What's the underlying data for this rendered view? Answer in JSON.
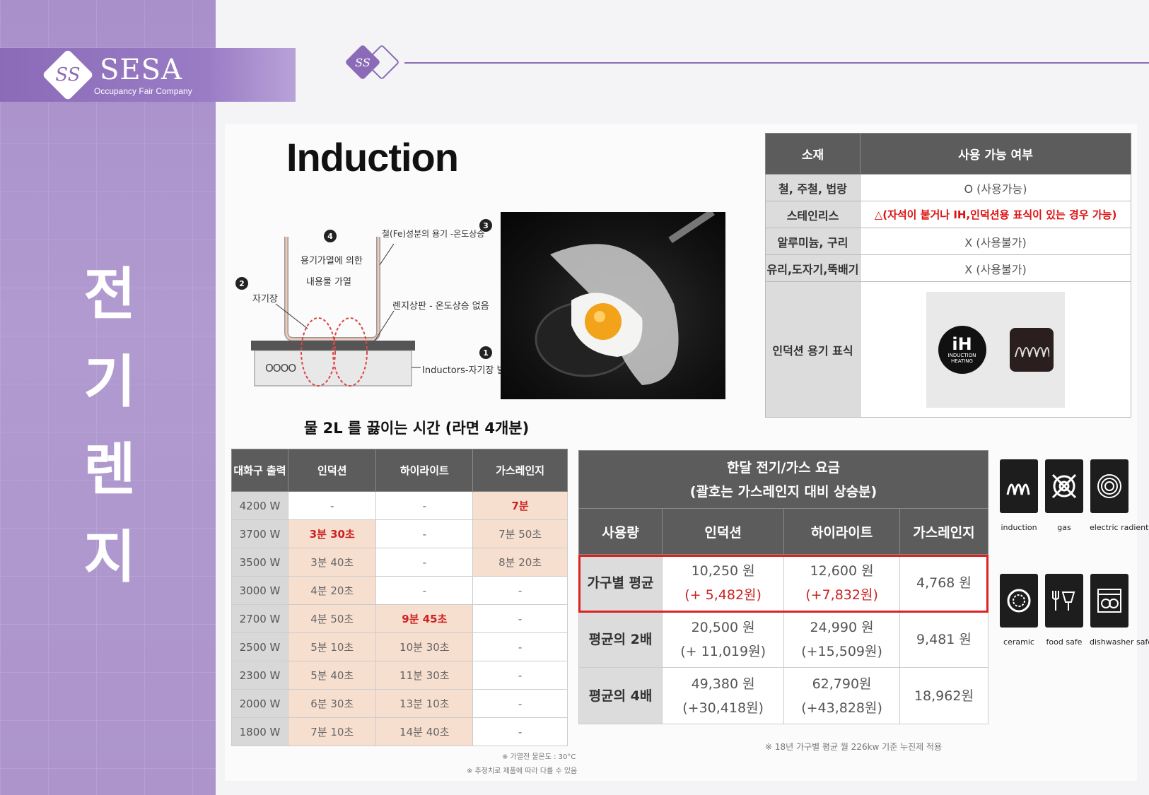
{
  "brand": {
    "name": "SESA",
    "tagline": "Occupancy Fair Company",
    "mark": "SS"
  },
  "page_title": [
    "전",
    "기",
    "렌",
    "지"
  ],
  "induction_title": "Induction",
  "diagram": {
    "labels": {
      "vessel_heat": "철(Fe)성분의 용기 -온도상승",
      "content_heat_1": "용기가열에 의한",
      "content_heat_2": "내용물 가열",
      "magnetic_field": "자기장",
      "plate": "렌지상판 - 온도상승 없음",
      "inductor": "Inductors-자기장 발생"
    },
    "numbers": [
      "1",
      "2",
      "3",
      "4"
    ],
    "coil": "OOOO"
  },
  "material_table": {
    "headers": [
      "소재",
      "사용 가능 여부"
    ],
    "rows": [
      {
        "material": "철, 주철, 법랑",
        "usage": "O (사용가능)"
      },
      {
        "material": "스테인리스",
        "usage": "△(자석이 붙거나 IH,인덕션용 표식이 있는 경우 가능)"
      },
      {
        "material": "알루미늄, 구리",
        "usage": "X (사용불가)"
      },
      {
        "material": "유리,도자기,뚝배기",
        "usage": "X (사용불가)"
      }
    ],
    "symbol_row_label": "인덕션 용기 표식",
    "ih_symbol": {
      "top": "iH",
      "line1": "INDUCTION",
      "line2": "HEATING"
    }
  },
  "boil_table": {
    "title": "물 2L 를  끓이는 시간 (라면 4개분)",
    "headers": [
      "대화구 출력",
      "인덕션",
      "하이라이트",
      "가스레인지"
    ],
    "rows": [
      [
        "4200 W",
        "-",
        "-",
        "7분"
      ],
      [
        "3700 W",
        "3분 30초",
        "-",
        "7분 50초"
      ],
      [
        "3500 W",
        "3분 40초",
        "-",
        "8분 20초"
      ],
      [
        "3000 W",
        "4분 20초",
        "-",
        "-"
      ],
      [
        "2700 W",
        "4분 50초",
        "9분 45초",
        "-"
      ],
      [
        "2500 W",
        "5분 10초",
        "10분 30초",
        "-"
      ],
      [
        "2300 W",
        "5분 40초",
        "11분 30초",
        "-"
      ],
      [
        "2000 W",
        "6분 30초",
        "13분 10초",
        "-"
      ],
      [
        "1800 W",
        "7분 10초",
        "14분 40초",
        "-"
      ]
    ],
    "notes": [
      "※ 가열전 물온도 : 30°C",
      "※ 추정치로 제품에 따라 다를 수 있음"
    ]
  },
  "fee_table": {
    "title_line1": "한달 전기/가스 요금",
    "title_line2": "(괄호는 가스레인지 대비 상승분)",
    "headers": [
      "사용량",
      "인덕션",
      "하이라이트",
      "가스레인지"
    ],
    "rows": [
      {
        "label": "가구별 평균",
        "induction": "10,250 원",
        "induction_diff": "(+ 5,482원)",
        "highlight": "12,600 원",
        "highlight_diff": "(+7,832원)",
        "gas": "4,768 원"
      },
      {
        "label": "평균의 2배",
        "induction": "20,500 원",
        "induction_diff": "(+ 11,019원)",
        "highlight": "24,990 원",
        "highlight_diff": "(+15,509원)",
        "gas": "9,481 원"
      },
      {
        "label": "평균의 4배",
        "induction": "49,380 원",
        "induction_diff": "(+30,418원)",
        "highlight": "62,790원",
        "highlight_diff": "(+43,828원)",
        "gas": "18,962원"
      }
    ],
    "note": "※ 18년 가구별 평균 월 226kw 기준 누진제 적용"
  },
  "cookware_icons": [
    {
      "name": "induction"
    },
    {
      "name": "gas"
    },
    {
      "name": "electric radient"
    },
    {
      "name": "ceramic"
    },
    {
      "name": "food safe"
    },
    {
      "name": "dishwasher safe"
    }
  ],
  "colors": {
    "brand_purple": "#8b6bb8",
    "band_purple": "#ad95cc",
    "header_gray": "#5c5c5c",
    "highlight_peach": "#f7dfd0",
    "alert_red": "#d11111"
  }
}
